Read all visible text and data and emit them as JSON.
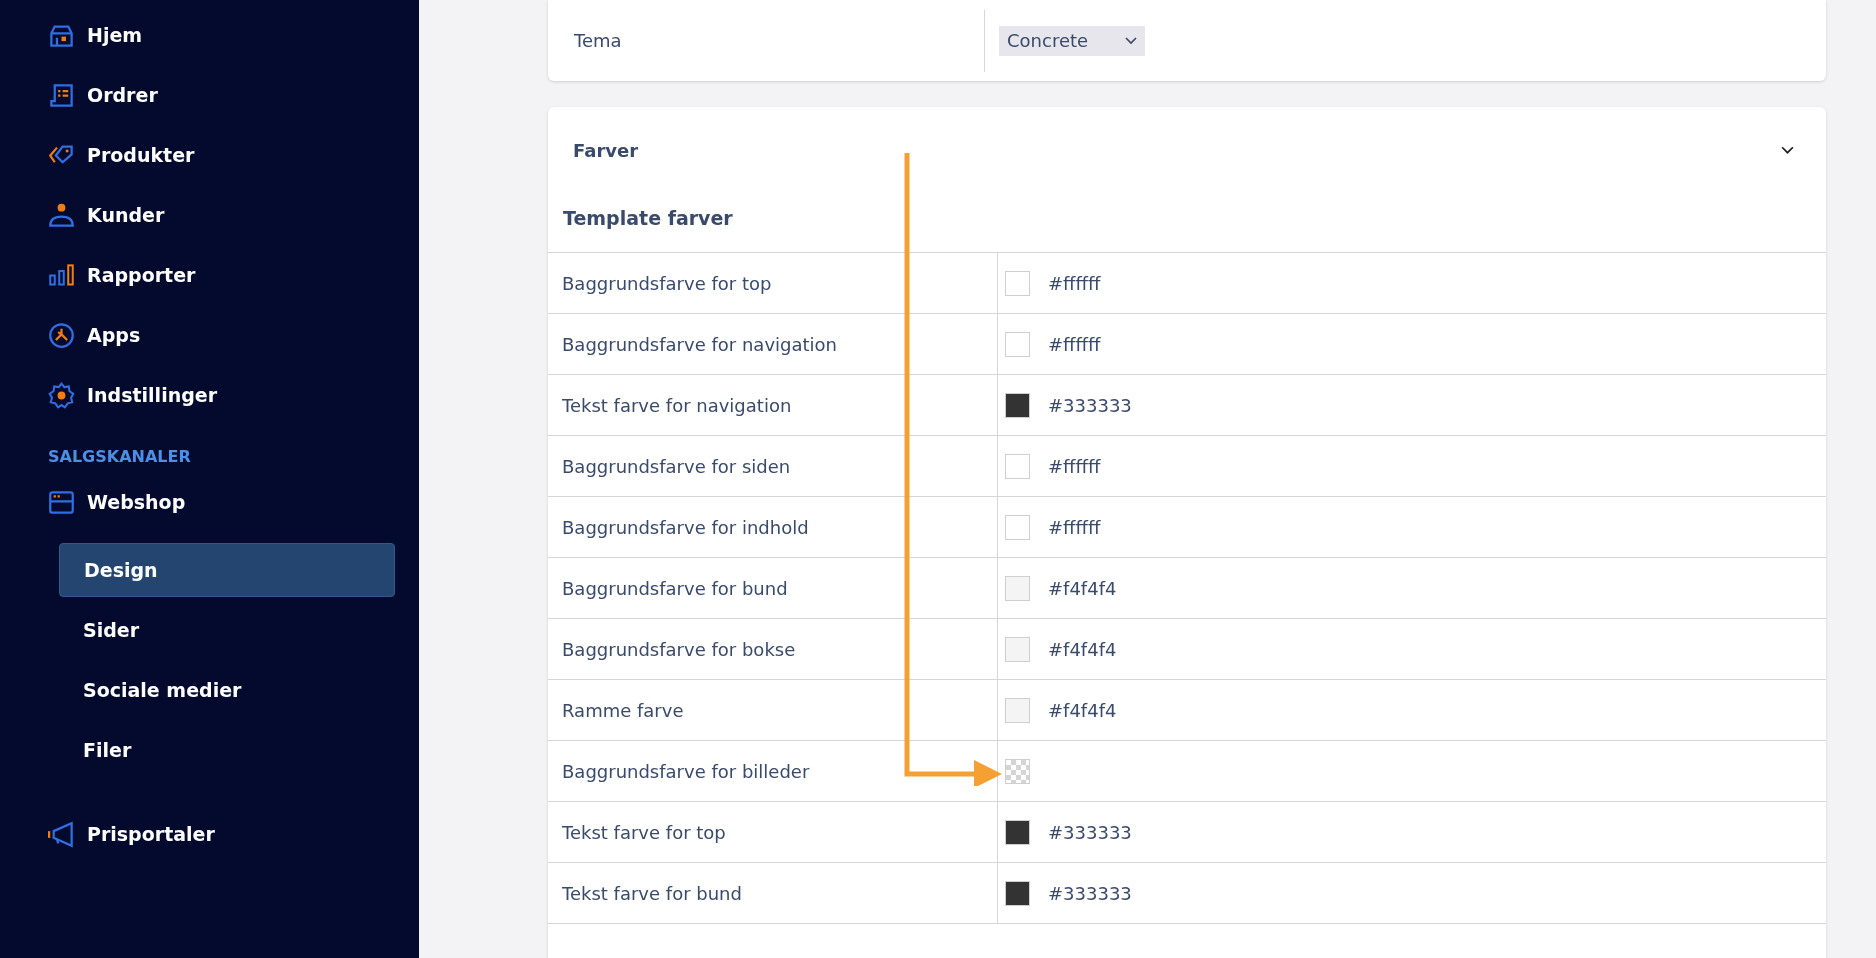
{
  "sidebar": {
    "main_items": [
      {
        "label": "Hjem",
        "selected": false
      },
      {
        "label": "Ordrer",
        "selected": false
      },
      {
        "label": "Produkter",
        "selected": false
      },
      {
        "label": "Kunder",
        "selected": false
      },
      {
        "label": "Rapporter",
        "selected": false
      },
      {
        "label": "Apps",
        "selected": false
      },
      {
        "label": "Indstillinger",
        "selected": false
      }
    ],
    "section_title": "SALGSKANALER",
    "channels": [
      {
        "label": "Webshop",
        "children": [
          {
            "label": "Design",
            "selected": true
          },
          {
            "label": "Sider",
            "selected": false
          },
          {
            "label": "Sociale medier",
            "selected": false
          },
          {
            "label": "Filer",
            "selected": false
          }
        ]
      },
      {
        "label": "Prisportaler"
      }
    ]
  },
  "theme_card": {
    "label": "Tema",
    "select_value": "Concrete"
  },
  "colors_card": {
    "title": "Farver",
    "expanded": true,
    "subtitle": "Template farver",
    "rows": [
      {
        "label": "Baggrundsfarve for top",
        "kind": "solid",
        "color": "#ffffff",
        "value": "#ffffff"
      },
      {
        "label": "Baggrundsfarve for navigation",
        "kind": "solid",
        "color": "#ffffff",
        "value": "#ffffff"
      },
      {
        "label": "Tekst farve for navigation",
        "kind": "solid",
        "color": "#333333",
        "value": "#333333"
      },
      {
        "label": "Baggrundsfarve for siden",
        "kind": "solid",
        "color": "#ffffff",
        "value": "#ffffff"
      },
      {
        "label": "Baggrundsfarve for indhold",
        "kind": "solid",
        "color": "#ffffff",
        "value": "#ffffff"
      },
      {
        "label": "Baggrundsfarve for bund",
        "kind": "solid",
        "color": "#f4f4f4",
        "value": "#f4f4f4"
      },
      {
        "label": "Baggrundsfarve for bokse",
        "kind": "solid",
        "color": "#f4f4f4",
        "value": "#f4f4f4"
      },
      {
        "label": "Ramme farve",
        "kind": "solid",
        "color": "#f4f4f4",
        "value": "#f4f4f4"
      },
      {
        "label": "Baggrundsfarve for billeder",
        "kind": "transparent"
      },
      {
        "label": "Tekst farve for top",
        "kind": "solid",
        "color": "#333333",
        "value": "#333333"
      },
      {
        "label": "Tekst farve for bund",
        "kind": "solid",
        "color": "#333333",
        "value": "#333333"
      }
    ]
  }
}
